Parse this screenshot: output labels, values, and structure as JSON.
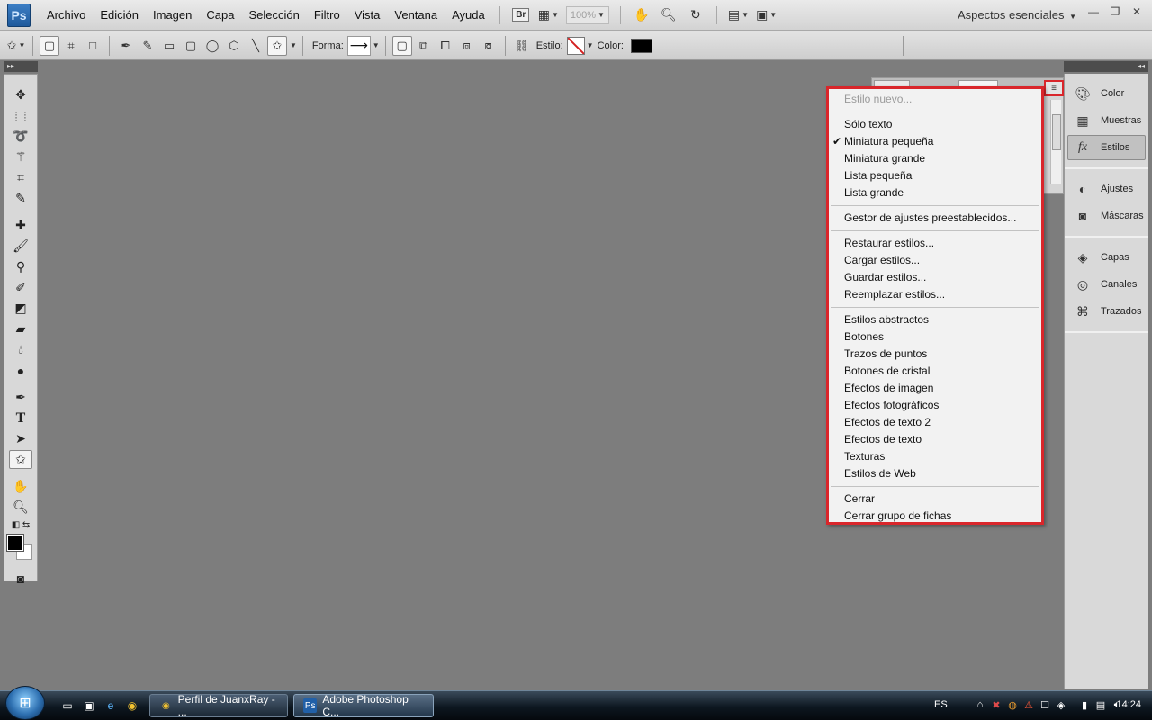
{
  "app": {
    "logo_text": "Ps"
  },
  "menubar": {
    "items": [
      "Archivo",
      "Edición",
      "Imagen",
      "Capa",
      "Selección",
      "Filtro",
      "Vista",
      "Ventana",
      "Ayuda"
    ],
    "bridge_label": "Br",
    "zoom": "100%",
    "workspace": "Aspectos esenciales"
  },
  "optionsbar": {
    "forma_label": "Forma:",
    "estilo_label": "Estilo:",
    "color_label": "Color:",
    "color_value": "#000000"
  },
  "dock": {
    "items": [
      {
        "label": "Color",
        "icon": "palette-icon"
      },
      {
        "label": "Muestras",
        "icon": "swatches-icon"
      },
      {
        "label": "Estilos",
        "icon": "fx-icon",
        "active": true
      },
      {
        "label": "Ajustes",
        "icon": "adjustments-icon"
      },
      {
        "label": "Máscaras",
        "icon": "mask-icon"
      },
      {
        "label": "Capas",
        "icon": "layers-icon"
      },
      {
        "label": "Canales",
        "icon": "channels-icon"
      },
      {
        "label": "Trazados",
        "icon": "paths-icon"
      }
    ]
  },
  "flyout": {
    "new_style": "Estilo nuevo...",
    "view": [
      "Sólo texto",
      "Miniatura pequeña",
      "Miniatura grande",
      "Lista pequeña",
      "Lista grande"
    ],
    "view_checked": "Miniatura pequeña",
    "preset_manager": "Gestor de ajustes preestablecidos...",
    "file_ops": [
      "Restaurar estilos...",
      "Cargar estilos...",
      "Guardar estilos...",
      "Reemplazar estilos..."
    ],
    "libraries": [
      "Estilos abstractos",
      "Botones",
      "Trazos de puntos",
      "Botones de cristal",
      "Efectos de imagen",
      "Efectos fotográficos",
      "Efectos de texto 2",
      "Efectos de texto",
      "Texturas",
      "Estilos de Web"
    ],
    "close": [
      "Cerrar",
      "Cerrar grupo de fichas"
    ]
  },
  "taskbar": {
    "tasks": [
      {
        "label": "Perfil de JuanxRay - ...",
        "icon": "chrome-icon"
      },
      {
        "label": "Adobe Photoshop C...",
        "icon": "photoshop-icon",
        "active": true
      }
    ],
    "language": "ES",
    "clock": "14:24"
  },
  "colors": {
    "highlight": "#d9262b",
    "canvas": "#7d7d7d"
  }
}
